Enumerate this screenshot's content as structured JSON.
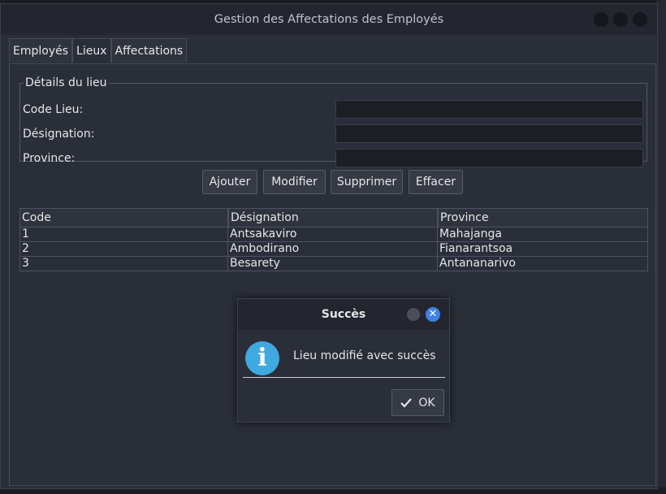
{
  "window": {
    "title": "Gestion des Affectations des Employés"
  },
  "tabs": [
    {
      "label": "Employés",
      "active": false
    },
    {
      "label": "Lieux",
      "active": true
    },
    {
      "label": "Affectations",
      "active": false
    }
  ],
  "details": {
    "legend": "Détails du lieu",
    "fields": [
      {
        "label": "Code Lieu:",
        "value": ""
      },
      {
        "label": "Désignation:",
        "value": ""
      },
      {
        "label": "Province:",
        "value": ""
      }
    ]
  },
  "actions": {
    "add": "Ajouter",
    "modify": "Modifier",
    "delete": "Supprimer",
    "clear": "Effacer"
  },
  "table": {
    "columns": [
      "Code",
      "Désignation",
      "Province"
    ],
    "rows": [
      [
        "1",
        "Antsakaviro",
        "Mahajanga"
      ],
      [
        "2",
        "Ambodirano",
        "Fianarantsoa"
      ],
      [
        "3",
        "Besarety",
        "Antananarivo"
      ]
    ]
  },
  "dialog": {
    "title": "Succès",
    "message": "Lieu modifié avec succès",
    "ok_label": "OK",
    "icon": "info-icon"
  },
  "colors": {
    "accent": "#3d82e6",
    "info": "#3fa9e0"
  }
}
